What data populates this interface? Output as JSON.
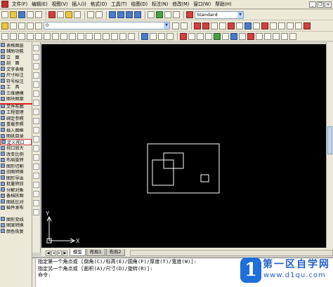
{
  "menubar": {
    "items": [
      "文件(F)",
      "编辑(E)",
      "视图(V)",
      "插入(I)",
      "格式(O)",
      "工具(T)",
      "绘图(D)",
      "标注(N)",
      "修改(M)",
      "窗口(W)",
      "帮助(H)"
    ]
  },
  "toolbar": {
    "style_combo": "Standard",
    "layer_combo": "0"
  },
  "left_panel": {
    "items": [
      {
        "label": "表格图层"
      },
      {
        "label": "辅助功能"
      },
      {
        "label": "立　面"
      },
      {
        "label": "剖　面"
      },
      {
        "label": "文字表格"
      },
      {
        "label": "尺寸标注"
      },
      {
        "label": "符号标注"
      },
      {
        "label": "工　具"
      },
      {
        "label": "三维建模"
      },
      {
        "label": "图块图案"
      },
      {
        "label": "文件布图"
      },
      {
        "label": "工程管理"
      },
      {
        "label": "绑定参照"
      },
      {
        "label": "重载参照"
      },
      {
        "label": "插入图框"
      },
      {
        "label": "图纸目录"
      },
      {
        "label": "定义视口"
      },
      {
        "label": "视口放大"
      },
      {
        "label": "改变比例"
      },
      {
        "label": "布局旋转"
      },
      {
        "label": "图形切割"
      },
      {
        "label": "旧图转换"
      },
      {
        "label": "图形导出"
      },
      {
        "label": "批量转旧"
      },
      {
        "label": "分解对象"
      },
      {
        "label": "备档拆图"
      },
      {
        "label": "图纸比对"
      },
      {
        "label": "插件发布"
      },
      {
        "label": "图形变线"
      },
      {
        "label": "图案转换"
      },
      {
        "label": "颜色恢复"
      }
    ]
  },
  "tabs": [
    "模型",
    "布局1",
    "布局2"
  ],
  "command": {
    "lines": [
      "指定第一个角点或 [倒角(C)/标高(E)/圆角(F)/厚度(T)/宽度(W)]:",
      "指定另一个角点或 [面积(A)/尺寸(D)/旋转(R)]:",
      "命令:"
    ]
  },
  "ucs": {
    "x_label": "X",
    "y_label": "Y"
  },
  "watermark": {
    "badge": "1",
    "title": "第一区自学网",
    "url": "www.d1qu.com"
  },
  "colors": {
    "canvas_bg": "#000000",
    "entity": "#ffffff",
    "highlight": "#e02020"
  }
}
